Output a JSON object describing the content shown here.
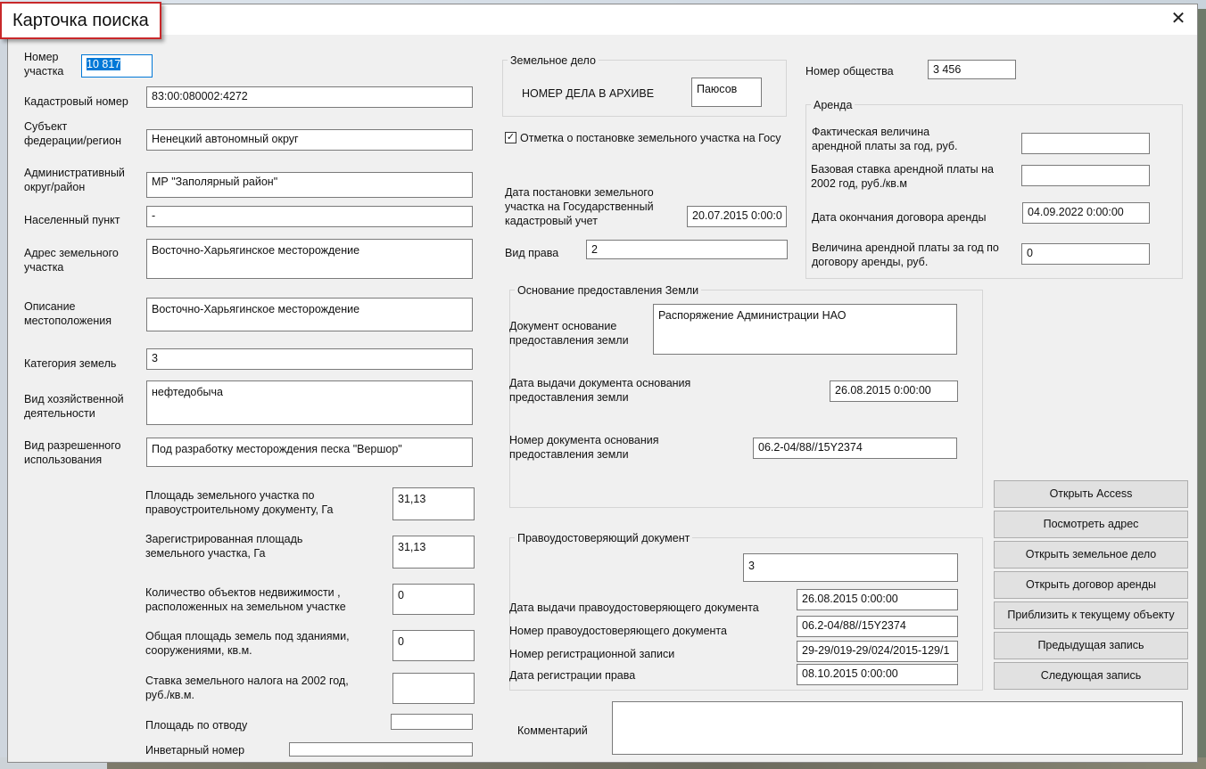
{
  "window": {
    "title": "Карточка поиска",
    "close_glyph": "✕"
  },
  "left": {
    "uchastok_label": "Номер\nучастка",
    "uchastok_value": "10 817",
    "kadastr_label": "Кадастровый номер",
    "kadastr_value": "83:00:080002:4272",
    "subject_label": "Субъект\nфедерации/регион",
    "subject_value": "Ненецкий автономный округ",
    "admin_label": "Административный\nокруг/район",
    "admin_value": "МР \"Заполярный район\"",
    "np_label": "Населенный пункт",
    "np_value": "-",
    "address_label": "Адрес земельного\nучастка",
    "address_value": "Восточно-Харьягинское месторождение",
    "opis_label": "Описание\nместоположения",
    "opis_value": "Восточно-Харьягинское месторождение",
    "kateg_label": "Категория земель",
    "kateg_value": "3",
    "hoz_label": "Вид хозяйственной\nдеятельности",
    "hoz_value": "нефтедобыча",
    "razr_label": "Вид разрешенного\nиспользования",
    "razr_value": "Под разработку месторождения песка \"Вершор\"",
    "ploshad_doc_label": "Площадь земельного участка по\nправоустроительному документу, Га",
    "ploshad_doc_value": "31,13",
    "ploshad_reg_label": "Зарегистрированная площадь\nземельного участка, Га",
    "ploshad_reg_value": "31,13",
    "kolvo_label": "Количество объектов недвижимости ,\nрасположенных на земельном участке",
    "kolvo_value": "0",
    "obsh_label": "Общая площадь земель под зданиями,\nсооружениями, кв.м.",
    "obsh_value": "0",
    "stavka_label": "Ставка земельного налога на 2002 год,\nруб./кв.м.",
    "stavka_value": "",
    "otvod_label": "Площадь по отводу",
    "otvod_value": "",
    "inv_label": "Инветарный номер",
    "inv_value": ""
  },
  "zem_delo": {
    "title": "Земельное дело",
    "archive_label": "НОМЕР ДЕЛА В АРХИВЕ",
    "archive_value": "Паюсов"
  },
  "gos_check": {
    "label": "Отметка о постановке земельного участка на Госу",
    "checked": true,
    "mark": "✓"
  },
  "date_post": {
    "label": "Дата постановки земельного\nучастка на Государственный\nкадастровый учет",
    "value": "20.07.2015 0:00:0"
  },
  "vid_prava": {
    "label": "Вид права",
    "value": "2"
  },
  "osnovanie": {
    "title": "Основание предоставления Земли",
    "doc_label": "Документ основание\nпредоставления земли",
    "doc_value": "Распоряжение Администрации НАО",
    "date_label": "Дата выдачи документа  основания\nпредоставления земли",
    "date_value": "26.08.2015 0:00:00",
    "num_label": "Номер документа основания\nпредоставления земли",
    "num_value": "06.2-04/88//15Y2374"
  },
  "pravo": {
    "title": "Правоудостоверяющий документ",
    "top_value": "3",
    "date_label": "Дата выдачи правоудостоверяющего документа",
    "date_value": "26.08.2015 0:00:00",
    "num_label": "Номер правоудостоверяющего документа",
    "num_value": "06.2-04/88//15Y2374",
    "reg_label": "Номер регистрационной записи",
    "reg_value": "29-29/019-29/024/2015-129/1",
    "regdate_label": "Дата регистрации права",
    "regdate_value": "08.10.2015 0:00:00"
  },
  "obshestvo": {
    "label": "Номер общества",
    "value": "3 456"
  },
  "arenda": {
    "title": "Аренда",
    "fakt_label": "Фактическая величина\nарендной платы за год, руб.",
    "fakt_value": "",
    "baza_label": "Базовая ставка арендной платы на\n2002 год, руб./кв.м",
    "baza_value": "",
    "end_label": "Дата окончания договора аренды",
    "end_value": "04.09.2022 0:00:00",
    "velich_label": "Величина арендной платы за год по\nдоговору аренды, руб.",
    "velich_value": "0"
  },
  "buttons": {
    "access": "Открыть Access",
    "address": "Посмотреть адрес",
    "zemdelo": "Открыть земельное дело",
    "dogovor": "Открыть договор аренды",
    "zoom": "Приблизить к текущему объекту",
    "prev": "Предыдущая запись",
    "next": "Следующая запись"
  },
  "comment": {
    "label": "Комментарий",
    "value": ""
  }
}
